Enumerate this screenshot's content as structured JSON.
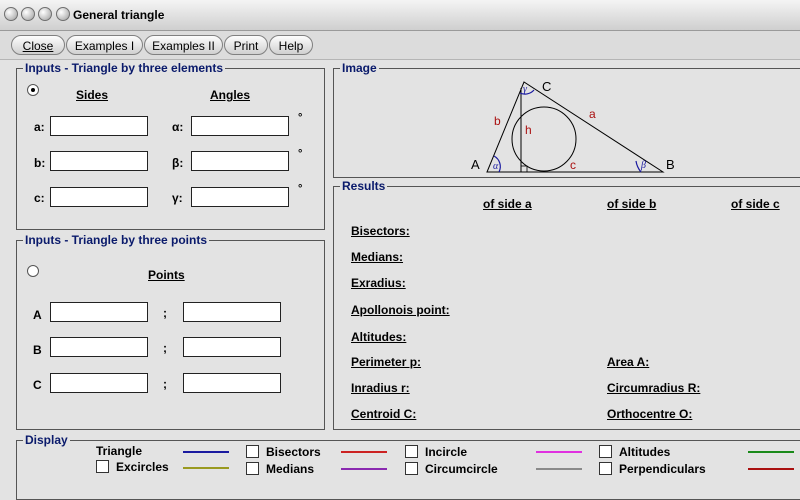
{
  "window": {
    "title": "General triangle"
  },
  "menu": [
    "Close",
    "Examples I",
    "Examples II",
    "Print",
    "Help"
  ],
  "inputs_elements": {
    "title": "Inputs - Triangle by three elements",
    "sides_header": "Sides",
    "angles_header": "Angles",
    "side_labels": [
      "a:",
      "b:",
      "c:"
    ],
    "angle_labels": [
      "α:",
      "β:",
      "γ:"
    ],
    "degree_symbol": "°",
    "selected": true
  },
  "inputs_points": {
    "title": "Inputs - Triangle by three points",
    "points_header": "Points",
    "point_labels": [
      "A",
      "B",
      "C"
    ],
    "separator": ";",
    "selected": false
  },
  "image": {
    "title": "Image",
    "vertex_labels": {
      "A": "A",
      "B": "B",
      "C": "C"
    },
    "side_labels": {
      "a": "a",
      "b": "b",
      "c": "c",
      "h": "h"
    },
    "angle_labels": {
      "alpha": "α",
      "beta": "β",
      "gamma": "γ"
    }
  },
  "results": {
    "title": "Results",
    "col_headers": [
      "of side a",
      "of side b",
      "of side c"
    ],
    "rows": [
      "Bisectors:",
      "Medians:",
      "Exradius:",
      "Apollonois point:",
      "Altitudes:"
    ],
    "left_props": [
      "Perimeter p:",
      "Inradius r:",
      "Centroid C:"
    ],
    "right_props": [
      "Area A:",
      "Circumradius R:",
      "Orthocentre O:"
    ]
  },
  "display": {
    "title": "Display",
    "items": [
      {
        "label": "Triangle",
        "color": "#1a1aa0",
        "checkbox": false
      },
      {
        "label": "Excircles",
        "color": "#9a9a20",
        "checkbox": true
      },
      {
        "label": "Bisectors",
        "color": "#cc2222",
        "checkbox": true
      },
      {
        "label": "Medians",
        "color": "#8a2ab0",
        "checkbox": true
      },
      {
        "label": "Incircle",
        "color": "#e030e0",
        "checkbox": true
      },
      {
        "label": "Circumcircle",
        "color": "#8a8a8a",
        "checkbox": true
      },
      {
        "label": "Altitudes",
        "color": "#1a8a1a",
        "checkbox": true
      },
      {
        "label": "Perpendiculars",
        "color": "#aa1111",
        "checkbox": true
      }
    ]
  }
}
